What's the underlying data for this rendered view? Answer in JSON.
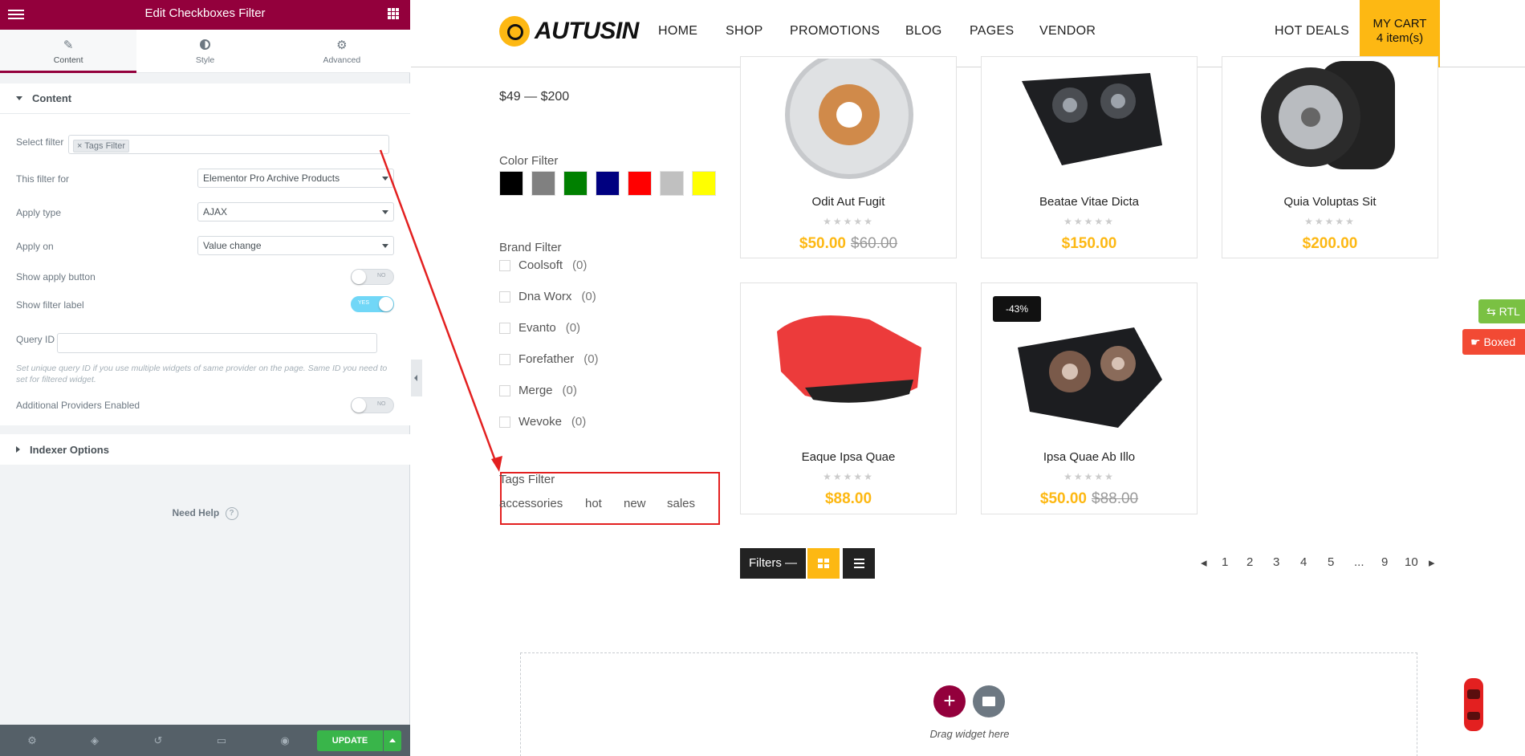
{
  "panel": {
    "title": "Edit Checkboxes Filter",
    "tabs": [
      {
        "label": "Content",
        "icon": "pencil-icon"
      },
      {
        "label": "Style",
        "icon": "half-circle-icon"
      },
      {
        "label": "Advanced",
        "icon": "gear-icon"
      }
    ],
    "section_content": "Content",
    "controls": {
      "select_filter_label": "Select filter",
      "select_filter_value": "× Tags Filter",
      "filter_for_label": "This filter for",
      "filter_for_value": "Elementor Pro Archive Products",
      "apply_type_label": "Apply type",
      "apply_type_value": "AJAX",
      "apply_on_label": "Apply on",
      "apply_on_value": "Value change",
      "show_apply_label": "Show apply button",
      "show_apply_state": "NO",
      "show_filter_label": "Show filter label",
      "show_filter_state": "YES",
      "query_id_label": "Query ID",
      "query_id_desc": "Set unique query ID if you use multiple widgets of same provider on the page. Same ID you need to set for filtered widget.",
      "additional_label": "Additional Providers Enabled",
      "additional_state": "NO"
    },
    "section_indexer": "Indexer Options",
    "need_help": "Need Help",
    "update_label": "UPDATE",
    "accent": "#93003c"
  },
  "site": {
    "logo": "AUTUSIN",
    "nav": [
      "HOME",
      "SHOP",
      "PROMOTIONS",
      "BLOG",
      "PAGES",
      "VENDOR"
    ],
    "hot_deals": "HOT DEALS",
    "cart_title": "MY CART",
    "cart_count": "4 item(s)",
    "price_range": "$49 — $200",
    "color_filter_title": "Color Filter",
    "colors": [
      "#000000",
      "#808080",
      "#008000",
      "#000080",
      "#ff0000",
      "#c0c0c0",
      "#ffff00"
    ],
    "brand_filter_title": "Brand Filter",
    "brands": [
      {
        "name": "Coolsoft",
        "count": "(0)"
      },
      {
        "name": "Dna Worx",
        "count": "(0)"
      },
      {
        "name": "Evanto",
        "count": "(0)"
      },
      {
        "name": "Forefather",
        "count": "(0)"
      },
      {
        "name": "Merge",
        "count": "(0)"
      },
      {
        "name": "Wevoke",
        "count": "(0)"
      }
    ],
    "tags_filter_title": "Tags Filter",
    "tags": [
      "accessories",
      "hot",
      "new",
      "sales"
    ],
    "products": [
      {
        "name": "Odit Aut Fugit",
        "price": "$50.00",
        "old": "$60.00"
      },
      {
        "name": "Beatae Vitae Dicta",
        "price": "$150.00",
        "old": ""
      },
      {
        "name": "Quia Voluptas Sit",
        "price": "$200.00",
        "old": ""
      },
      {
        "name": "Eaque Ipsa Quae",
        "price": "$88.00",
        "old": ""
      },
      {
        "name": "Ipsa Quae Ab Illo",
        "price": "$50.00",
        "old": "$88.00",
        "badge": "-43%"
      }
    ],
    "stars": "★★★★★",
    "filters_button": "Filters —",
    "pages": [
      "1",
      "2",
      "3",
      "4",
      "5",
      "...",
      "9",
      "10"
    ],
    "drag_text": "Drag widget here",
    "rtl_label": "RTL",
    "boxed_label": "Boxed",
    "brand_yellow": "#fdb813"
  }
}
